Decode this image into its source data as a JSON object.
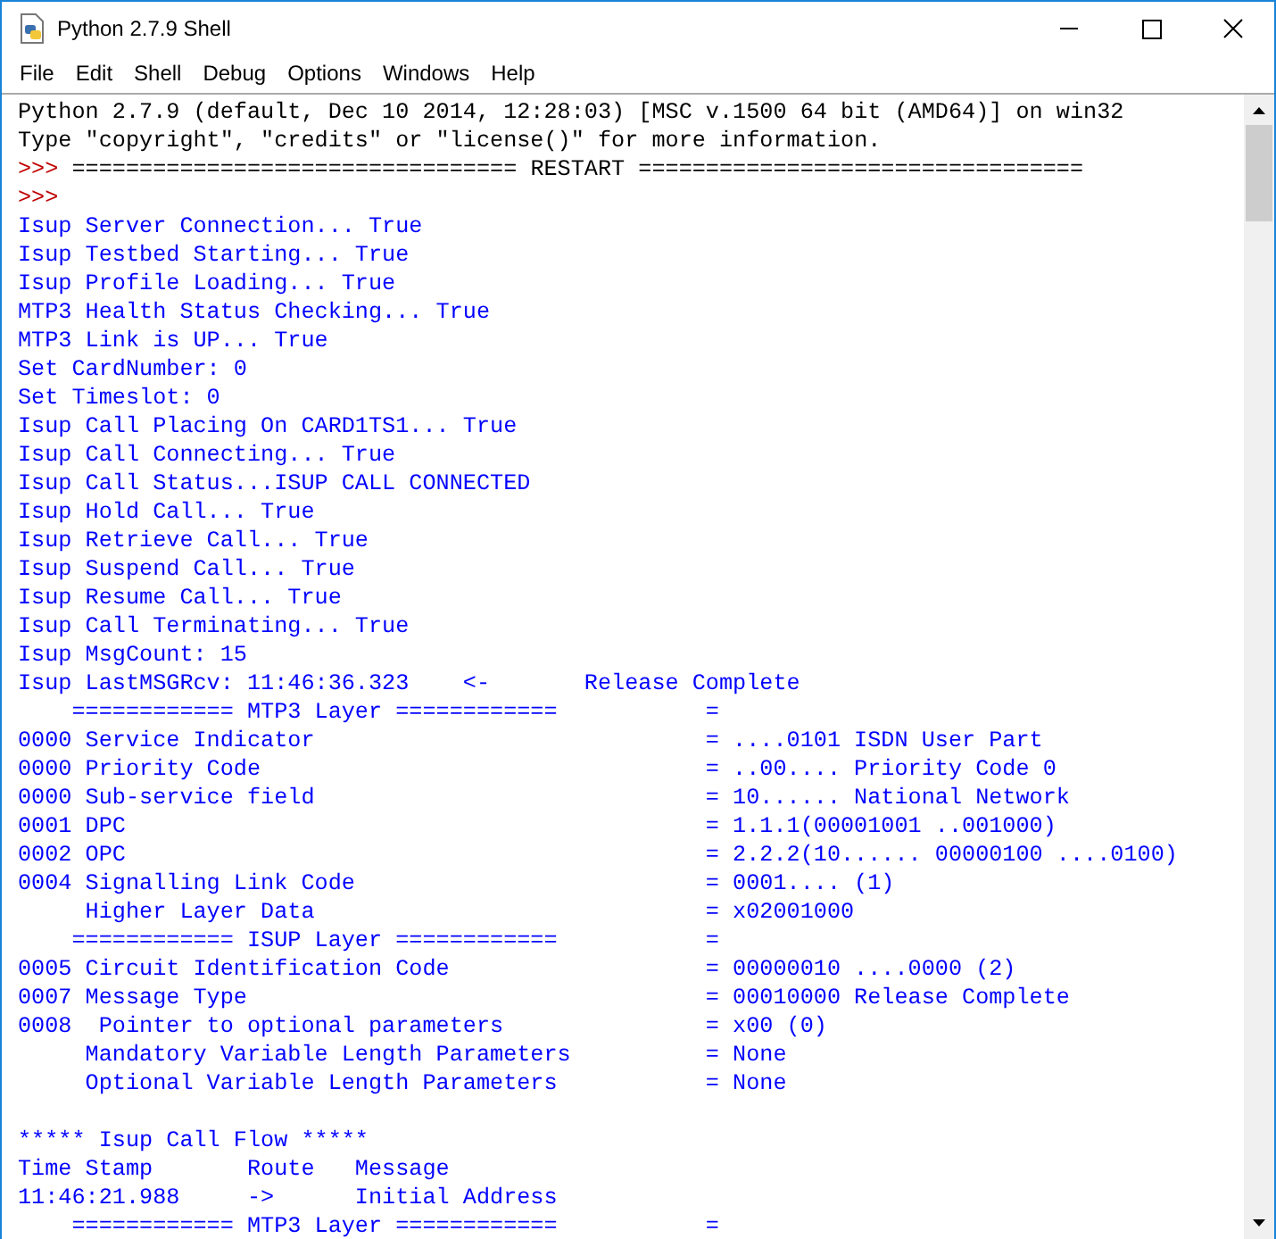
{
  "window": {
    "title": "Python 2.7.9 Shell"
  },
  "menu": [
    "File",
    "Edit",
    "Shell",
    "Debug",
    "Options",
    "Windows",
    "Help"
  ],
  "lines": [
    {
      "kind": "output",
      "text": "Python 2.7.9 (default, Dec 10 2014, 12:28:03) [MSC v.1500 64 bit (AMD64)] on win32"
    },
    {
      "kind": "output",
      "text": "Type \"copyright\", \"credits\" or \"license()\" for more information."
    },
    {
      "kind": "prompt",
      "prompt": ">>>",
      "text": "================================= RESTART ================================="
    },
    {
      "kind": "prompt",
      "prompt": ">>>"
    },
    {
      "kind": "stdout",
      "text": "Isup Server Connection... True"
    },
    {
      "kind": "stdout",
      "text": "Isup Testbed Starting... True"
    },
    {
      "kind": "stdout",
      "text": "Isup Profile Loading... True"
    },
    {
      "kind": "stdout",
      "text": "MTP3 Health Status Checking... True"
    },
    {
      "kind": "stdout",
      "text": "MTP3 Link is UP... True"
    },
    {
      "kind": "stdout",
      "text": "Set CardNumber: 0"
    },
    {
      "kind": "stdout",
      "text": "Set Timeslot: 0"
    },
    {
      "kind": "stdout",
      "text": "Isup Call Placing On CARD1TS1... True"
    },
    {
      "kind": "stdout",
      "text": "Isup Call Connecting... True"
    },
    {
      "kind": "stdout",
      "text": "Isup Call Status...ISUP CALL CONNECTED"
    },
    {
      "kind": "stdout",
      "text": "Isup Hold Call... True"
    },
    {
      "kind": "stdout",
      "text": "Isup Retrieve Call... True"
    },
    {
      "kind": "stdout",
      "text": "Isup Suspend Call... True"
    },
    {
      "kind": "stdout",
      "text": "Isup Resume Call... True"
    },
    {
      "kind": "stdout",
      "text": "Isup Call Terminating... True"
    },
    {
      "kind": "stdout",
      "text": "Isup MsgCount: 15"
    },
    {
      "kind": "stdout",
      "text": "Isup LastMSGRcv: 11:46:36.323    <-       Release Complete"
    },
    {
      "kind": "stdout",
      "text": "    ============ MTP3 Layer ============",
      "value": "="
    },
    {
      "kind": "stdout",
      "text": "0000 Service Indicator",
      "value": "= ....0101 ISDN User Part"
    },
    {
      "kind": "stdout",
      "text": "0000 Priority Code",
      "value": "= ..00.... Priority Code 0"
    },
    {
      "kind": "stdout",
      "text": "0000 Sub-service field",
      "value": "= 10...... National Network"
    },
    {
      "kind": "stdout",
      "text": "0001 DPC",
      "value": "= 1.1.1(00001001 ..001000)"
    },
    {
      "kind": "stdout",
      "text": "0002 OPC",
      "value": "= 2.2.2(10...... 00000100 ....0100)"
    },
    {
      "kind": "stdout",
      "text": "0004 Signalling Link Code",
      "value": "= 0001.... (1)"
    },
    {
      "kind": "stdout",
      "text": "     Higher Layer Data",
      "value": "= x02001000"
    },
    {
      "kind": "stdout",
      "text": "    ============ ISUP Layer ============",
      "value": "="
    },
    {
      "kind": "stdout",
      "text": "0005 Circuit Identification Code",
      "value": "= 00000010 ....0000 (2)"
    },
    {
      "kind": "stdout",
      "text": "0007 Message Type",
      "value": "= 00010000 Release Complete"
    },
    {
      "kind": "stdout",
      "text": "0008  Pointer to optional parameters",
      "value": "= x00 (0)"
    },
    {
      "kind": "stdout",
      "text": "     Mandatory Variable Length Parameters",
      "value": "= None"
    },
    {
      "kind": "stdout",
      "text": "     Optional Variable Length Parameters",
      "value": "= None"
    },
    {
      "kind": "blank"
    },
    {
      "kind": "stdout",
      "text": "***** Isup Call Flow *****"
    },
    {
      "kind": "stdout",
      "text": "Time Stamp       Route   Message"
    },
    {
      "kind": "stdout",
      "text": "11:46:21.988     ->      Initial Address"
    },
    {
      "kind": "stdout",
      "text": "    ============ MTP3 Layer ============",
      "value": "="
    }
  ]
}
